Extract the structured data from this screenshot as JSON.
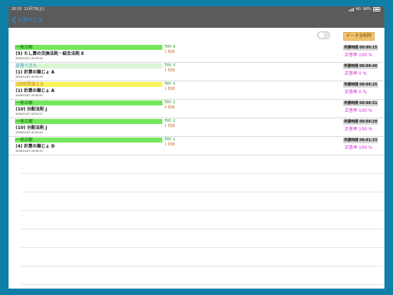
{
  "status_bar": {
    "time": "20:53",
    "date": "11月7日(土)",
    "network": "4G",
    "battery": "99%"
  },
  "nav": {
    "back_label": "計算の工夫"
  },
  "toolbar": {
    "delete_all_label": "データ全削除"
  },
  "colors": {
    "green": "#72e85a",
    "light_green": "#d9f7d3",
    "yellow": "#f6f65a",
    "accent_pink": "#d51fd5",
    "back_blue": "#2e8fdb"
  },
  "records": [
    {
      "result": "一発正解",
      "result_style": "green",
      "try": "TRY: 4",
      "question": "1 問目",
      "title": "(5) たし算の交換法則・結合法則 E",
      "date": "2020/11/07 20:53:19",
      "time": "所要時間 00:00:15",
      "rate": "正答率 100 %"
    },
    {
      "result": "正答できた",
      "result_style": "light_green",
      "try": "TRY: 3",
      "question": "1 問目",
      "title": "(1) 計算の順じょ A",
      "date": "2020/11/07 20:52:55",
      "time": "所要時間 00:00:40",
      "rate": "正答率 0 %"
    },
    {
      "result": "1回目間違える",
      "result_style": "yellow",
      "try": "TRY: 3",
      "question": "1 問目",
      "title": "(1) 計算の順じょ A",
      "date": "2020/11/07 20:52:41",
      "time": "所要時間 00:00:25",
      "rate": "正答率 0 %"
    },
    {
      "result": "一発正解",
      "result_style": "green",
      "try": "TRY: 2",
      "question": "4 問目",
      "title": "(10) 分配法則 J",
      "date": "2020/11/07 20:51:57",
      "time": "所要時間 00:00:31",
      "rate": "正答率 100 %"
    },
    {
      "result": "一発正解",
      "result_style": "green",
      "try": "TRY: 2",
      "question": "1 問目",
      "title": "(10) 分配法則 J",
      "date": "2020/11/07 20:51:24",
      "time": "所要時間 00:00:29",
      "rate": "正答率 100 %"
    },
    {
      "result": "一発正解",
      "result_style": "green",
      "try": "TRY: 1",
      "question": "1 問目",
      "title": "(4) 計算の順じょ D",
      "date": "2020/11/07 20:50:15",
      "time": "所要時間 00:01:33",
      "rate": "正答率 100 %"
    }
  ]
}
